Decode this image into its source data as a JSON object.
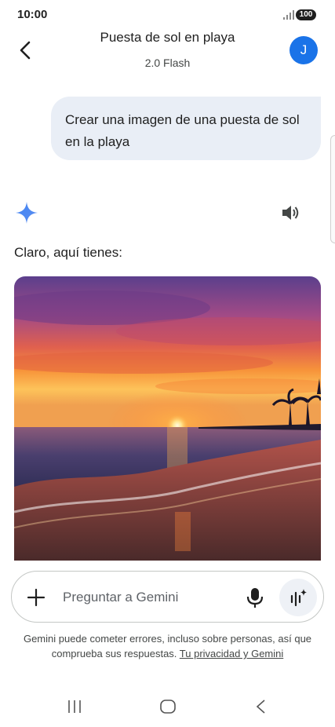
{
  "status_bar": {
    "time": "10:00",
    "battery": "100"
  },
  "header": {
    "title": "Puesta de sol en playa",
    "model": "2.0 Flash",
    "avatar_initial": "J"
  },
  "conversation": {
    "user_prompt": "Crear una imagen de una puesta de sol en la playa",
    "response_text": "Claro, aquí tienes:"
  },
  "input": {
    "placeholder": "Preguntar a Gemini"
  },
  "disclaimer": {
    "text": "Gemini puede cometer errores, incluso sobre personas, así que comprueba sus respuestas. ",
    "link": "Tu privacidad y Gemini"
  },
  "icons": {
    "back": "arrow-left-icon",
    "spark": "gemini-spark-icon",
    "speaker": "speaker-icon",
    "plus": "plus-icon",
    "mic": "microphone-icon",
    "live": "live-waveform-icon",
    "nav_recents": "recents-icon",
    "nav_home": "home-icon",
    "nav_back": "nav-back-icon"
  },
  "colors": {
    "accent": "#1a73e8",
    "user_bubble": "#e9eef6",
    "spark_blue": "#4285f4"
  }
}
